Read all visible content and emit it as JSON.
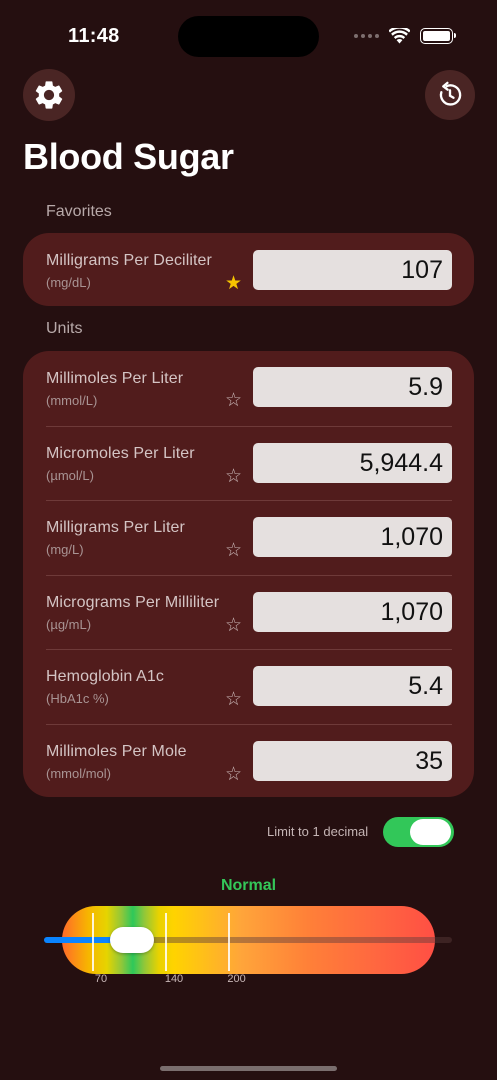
{
  "status_bar": {
    "time": "11:48"
  },
  "header": {
    "title": "Blood Sugar",
    "settings_icon": "gear-icon",
    "reset_icon": "reset-icon"
  },
  "favorites": {
    "label": "Favorites",
    "items": [
      {
        "name": "Milligrams Per Deciliter",
        "abbr": "(mg/dL)",
        "value": "107",
        "starred": true
      }
    ]
  },
  "units": {
    "label": "Units",
    "items": [
      {
        "name": "Millimoles Per Liter",
        "abbr": "(mmol/L)",
        "value": "5.9",
        "starred": false
      },
      {
        "name": "Micromoles Per Liter",
        "abbr": "(µmol/L)",
        "value": "5,944.4",
        "starred": false
      },
      {
        "name": "Milligrams Per Liter",
        "abbr": "(mg/L)",
        "value": "1,070",
        "starred": false
      },
      {
        "name": "Micrograms Per Milliliter",
        "abbr": "(µg/mL)",
        "value": "1,070",
        "starred": false
      },
      {
        "name": "Hemoglobin A1c",
        "abbr": "(HbA1c %)",
        "value": "5.4",
        "starred": false
      },
      {
        "name": "Millimoles Per Mole",
        "abbr": "(mmol/mol)",
        "value": "35",
        "starred": false
      }
    ]
  },
  "limit_toggle": {
    "label": "Limit to 1 decimal",
    "on": true
  },
  "gauge": {
    "status": "Normal",
    "status_color": "#34c759",
    "value": 107,
    "markers": [
      "70",
      "140",
      "200"
    ]
  },
  "colors": {
    "background": "#250f10",
    "card": "#511c1c",
    "accent_blue": "#0a84ff",
    "toggle_green": "#32c759",
    "star_gold": "#f5c400"
  }
}
